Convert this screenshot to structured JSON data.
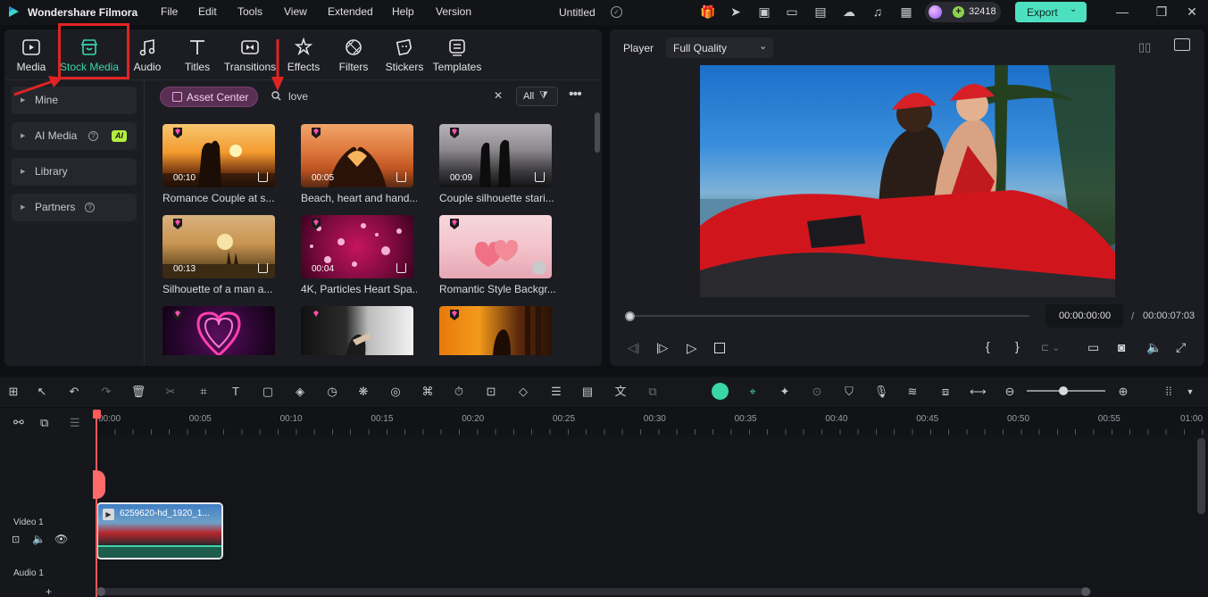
{
  "app": {
    "name": "Wondershare Filmora",
    "project_title": "Untitled",
    "credits": "32418",
    "export_label": "Export",
    "menus": [
      "File",
      "Edit",
      "Tools",
      "View",
      "Extended",
      "Help",
      "Version"
    ]
  },
  "tabs": [
    {
      "label": "Media",
      "icon": "media-icon"
    },
    {
      "label": "Stock Media",
      "icon": "stock-media-icon",
      "active": true
    },
    {
      "label": "Audio",
      "icon": "music-note-icon"
    },
    {
      "label": "Titles",
      "icon": "text-t-icon"
    },
    {
      "label": "Transitions",
      "icon": "transitions-icon"
    },
    {
      "label": "Effects",
      "icon": "effects-icon"
    },
    {
      "label": "Filters",
      "icon": "filters-icon"
    },
    {
      "label": "Stickers",
      "icon": "stickers-icon"
    },
    {
      "label": "Templates",
      "icon": "templates-icon"
    }
  ],
  "sidebar": {
    "items": [
      {
        "label": "Mine"
      },
      {
        "label": "AI Media",
        "badge": "AI"
      },
      {
        "label": "Library"
      },
      {
        "label": "Partners"
      }
    ]
  },
  "search": {
    "asset_center_label": "Asset Center",
    "query": "love",
    "filter_label": "All"
  },
  "media_items": [
    {
      "title": "Romance Couple at s...",
      "duration": "00:10"
    },
    {
      "title": "Beach, heart and hand...",
      "duration": "00:05"
    },
    {
      "title": "Couple silhouette stari...",
      "duration": "00:09"
    },
    {
      "title": "Silhouette of a man a...",
      "duration": "00:13"
    },
    {
      "title": "4K, Particles Heart Spa...",
      "duration": "00:04"
    },
    {
      "title": "Romantic Style Backgr...",
      "duration": ""
    },
    {
      "title": "",
      "duration": ""
    },
    {
      "title": "",
      "duration": ""
    },
    {
      "title": "",
      "duration": ""
    }
  ],
  "player": {
    "label": "Player",
    "quality": "Full Quality",
    "current_time": "00:00:00:00",
    "separator": "/",
    "total_time": "00:00:07:03"
  },
  "timeline": {
    "ticks": [
      "00:00",
      "00:05",
      "00:10",
      "00:15",
      "00:20",
      "00:25",
      "00:30",
      "00:35",
      "00:40",
      "00:45",
      "00:50",
      "00:55",
      "01:00"
    ],
    "video_track_label": "Video 1",
    "audio_track_label": "Audio 1",
    "clip_name": "6259620-hd_1920_1..."
  },
  "colors": {
    "accent": "#39d7b0",
    "highlight_red": "#e02424",
    "playhead": "#ff5a5a",
    "export_bg": "#4de0c0"
  }
}
